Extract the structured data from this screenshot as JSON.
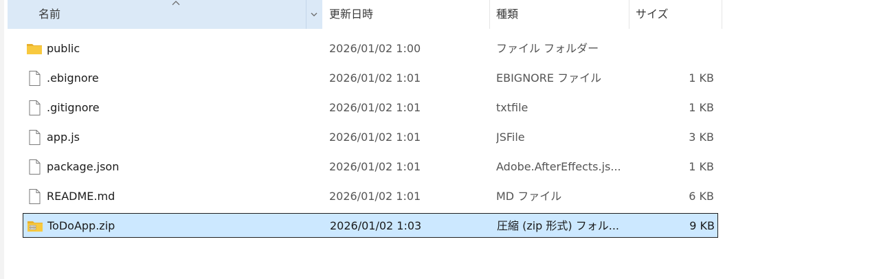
{
  "header": {
    "name_label": "名前",
    "date_label": "更新日時",
    "type_label": "種類",
    "size_label": "サイズ"
  },
  "files": [
    {
      "name": "public",
      "date": "2026/01/02 1:00",
      "type": "ファイル フォルダー",
      "size": "",
      "icon": "folder-icon"
    },
    {
      "name": ".ebignore",
      "date": "2026/01/02 1:01",
      "type": "EBIGNORE ファイル",
      "size": "1 KB",
      "icon": "file-icon"
    },
    {
      "name": ".gitignore",
      "date": "2026/01/02 1:01",
      "type": "txtfile",
      "size": "1 KB",
      "icon": "file-icon"
    },
    {
      "name": "app.js",
      "date": "2026/01/02 1:01",
      "type": "JSFile",
      "size": "3 KB",
      "icon": "file-icon"
    },
    {
      "name": "package.json",
      "date": "2026/01/02 1:01",
      "type": "Adobe.AfterEffects.js...",
      "size": "1 KB",
      "icon": "file-icon"
    },
    {
      "name": "README.md",
      "date": "2026/01/02 1:01",
      "type": "MD ファイル",
      "size": "6 KB",
      "icon": "file-icon"
    },
    {
      "name": "ToDoApp.zip",
      "date": "2026/01/02 1:03",
      "type": "圧縮 (zip 形式) フォル...",
      "size": "9 KB",
      "icon": "zip-folder-icon",
      "selected": true
    }
  ],
  "colors": {
    "header_sorted_bg": "#dbe9f7",
    "selection_bg": "#cce8ff",
    "folder_yellow": "#f8c93f"
  }
}
